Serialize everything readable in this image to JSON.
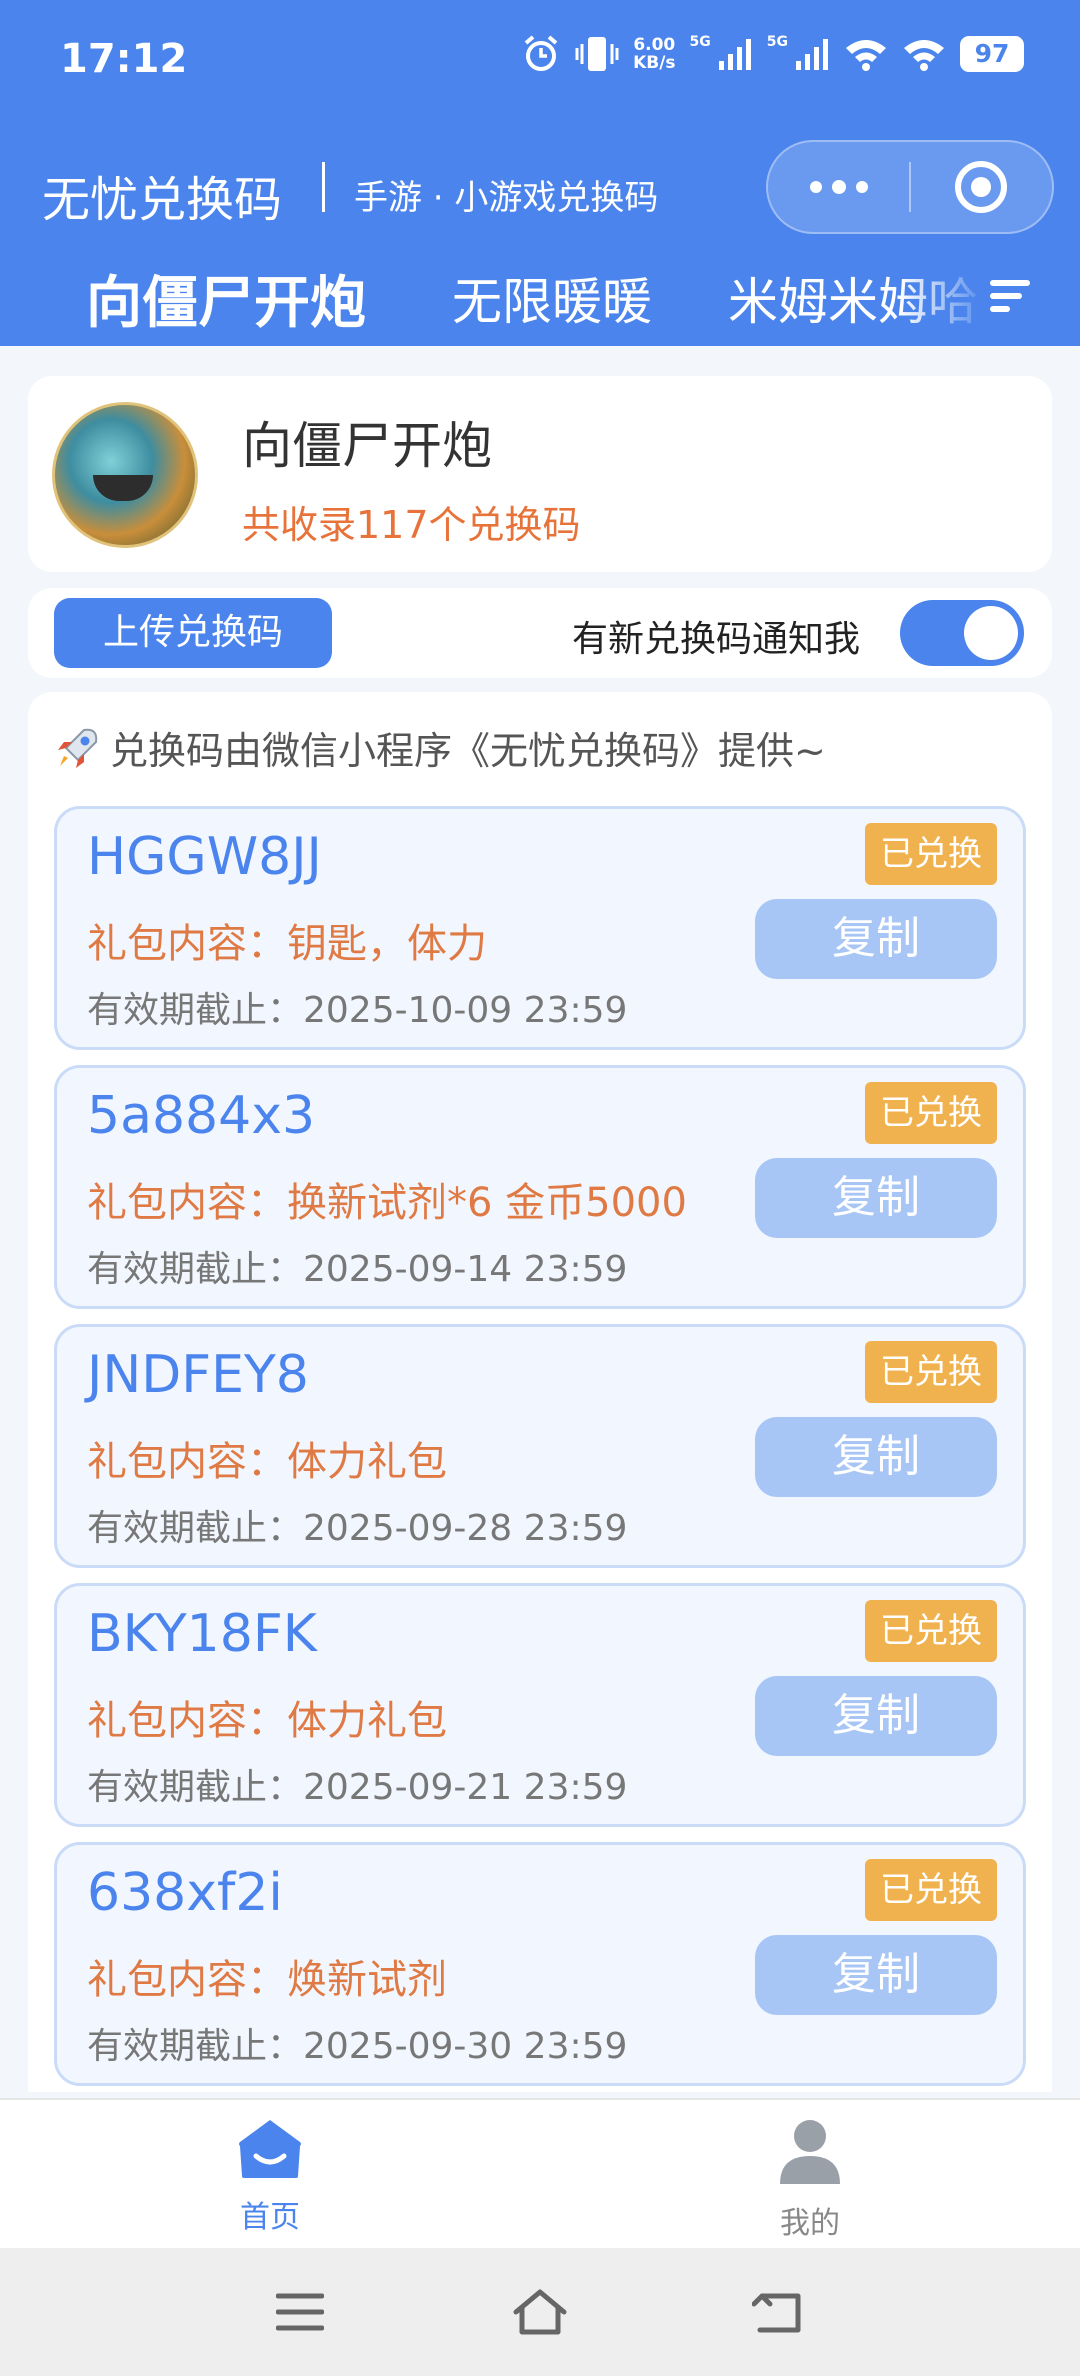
{
  "status_bar": {
    "time": "17:12",
    "net_speed_value": "6.00",
    "net_speed_unit": "KB/s",
    "signal_1": "5G",
    "signal_2": "5G",
    "battery": "97"
  },
  "title_bar": {
    "app_name": "无忧兑换码",
    "subtitle": "手游 · 小游戏兑换码"
  },
  "tabs": [
    {
      "label": "向僵尸开炮",
      "active": true
    },
    {
      "label": "无限暖暖",
      "active": false
    },
    {
      "label": "米姆米姆哈",
      "active": false
    }
  ],
  "game": {
    "name": "向僵尸开炮",
    "count_text": "共收录117个兑换码"
  },
  "actions": {
    "upload_label": "上传兑换码",
    "notify_label": "有新兑换码通知我",
    "notify_enabled": true
  },
  "notice": "兑换码由微信小程序《无忧兑换码》提供~",
  "codes": [
    {
      "code": "HGGW8JJ",
      "content": "礼包内容：钥匙，体力",
      "expire": "有效期截止：2025-10-09 23:59",
      "badge": "已兑换",
      "copy": "复制"
    },
    {
      "code": "5a884x3",
      "content": "礼包内容：换新试剂*6 金币5000",
      "expire": "有效期截止：2025-09-14 23:59",
      "badge": "已兑换",
      "copy": "复制"
    },
    {
      "code": "JNDFEY8",
      "content": "礼包内容：体力礼包",
      "expire": "有效期截止：2025-09-28 23:59",
      "badge": "已兑换",
      "copy": "复制"
    },
    {
      "code": "BKY18FK",
      "content": "礼包内容：体力礼包",
      "expire": "有效期截止：2025-09-21 23:59",
      "badge": "已兑换",
      "copy": "复制"
    },
    {
      "code": "638xf2i",
      "content": "礼包内容：焕新试剂",
      "expire": "有效期截止：2025-09-30 23:59",
      "badge": "已兑换",
      "copy": "复制"
    }
  ],
  "bottom_tabs": [
    {
      "label": "首页",
      "icon": "home-icon",
      "active": true
    },
    {
      "label": "我的",
      "icon": "person-icon",
      "active": false
    }
  ],
  "colors": {
    "primary": "#4a84ec",
    "accent_orange": "#e8733a",
    "badge": "#f0b24e",
    "copy_button": "#a8c6f5"
  }
}
